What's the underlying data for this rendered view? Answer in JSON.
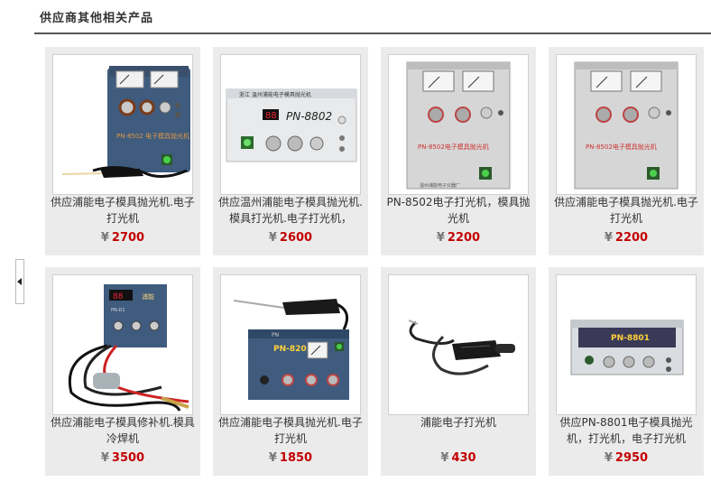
{
  "header": {
    "title": "供应商其他相关产品"
  },
  "currency_symbol": "¥",
  "products": [
    {
      "title": "供应浦能电子模具抛光机.电子打光机",
      "price": "2700",
      "machine": {
        "brand": "PN-8502",
        "subtitle": "电子模具抛光机"
      }
    },
    {
      "title": "供应温州浦能电子模具抛光机.模具打光机.电子打光机，",
      "price": "2600",
      "machine": {
        "header": "浙江 温州浦能电子模具抛光机",
        "model": "PN-8802",
        "display": "88"
      }
    },
    {
      "title": "PN-8502电子打光机，模具抛光机",
      "price": "2200",
      "machine": {
        "brand": "PN-8502电子模具抛光机",
        "footer": "温州浦能电子仪器厂"
      }
    },
    {
      "title": "供应浦能电子模具抛光机.电子打光机",
      "price": "2200",
      "machine": {
        "brand": "PN-8502电子模具抛光机"
      }
    },
    {
      "title": "供应浦能电子模具修补机.模具冷焊机",
      "price": "3500",
      "machine": {
        "display": "88",
        "brand": "浦能",
        "label": "PN-D1"
      }
    },
    {
      "title": "供应浦能电子模具抛光机.电子打光机",
      "price": "1850",
      "machine": {
        "model": "PN-8203"
      }
    },
    {
      "title": "浦能电子打光机",
      "price": "430",
      "machine": {}
    },
    {
      "title": "供应PN-8801电子模具抛光机，打光机，电子打光机",
      "price": "2950",
      "machine": {
        "model": "PN-8801"
      }
    }
  ]
}
